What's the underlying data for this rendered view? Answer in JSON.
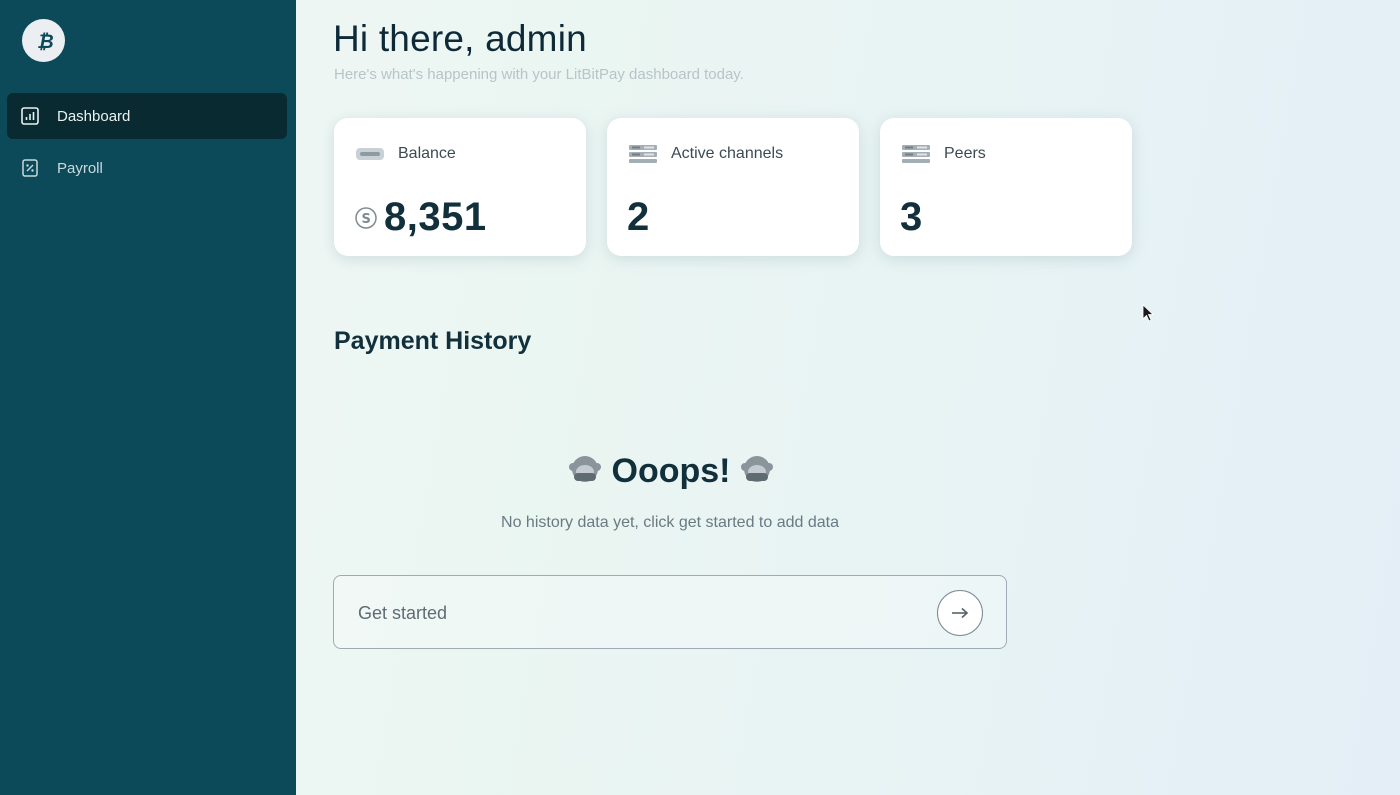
{
  "sidebar": {
    "logo_icon": "bitcoin-icon",
    "items": [
      {
        "label": "Dashboard",
        "icon": "chart-icon",
        "active": true
      },
      {
        "label": "Payroll",
        "icon": "payroll-icon",
        "active": false
      }
    ]
  },
  "header": {
    "greeting": "Hi there, admin",
    "subtitle": "Here's what's happening with your LitBitPay dashboard today."
  },
  "cards": [
    {
      "label": "Balance",
      "value": "8,351",
      "icon": "wallet-icon",
      "value_icon": "dollar-icon"
    },
    {
      "label": "Active channels",
      "value": "2",
      "icon": "server-icon"
    },
    {
      "label": "Peers",
      "value": "3",
      "icon": "server-icon"
    }
  ],
  "payment_history": {
    "title": "Payment History",
    "empty_title": "Ooops!",
    "empty_message": "No history data yet, click get started to add data",
    "cta_label": "Get started",
    "cta_icon": "arrow-right-icon"
  },
  "colors": {
    "sidebar_bg": "#0c4a5a",
    "sidebar_active_bg": "#0a2a32",
    "text_dark": "#12303c"
  }
}
